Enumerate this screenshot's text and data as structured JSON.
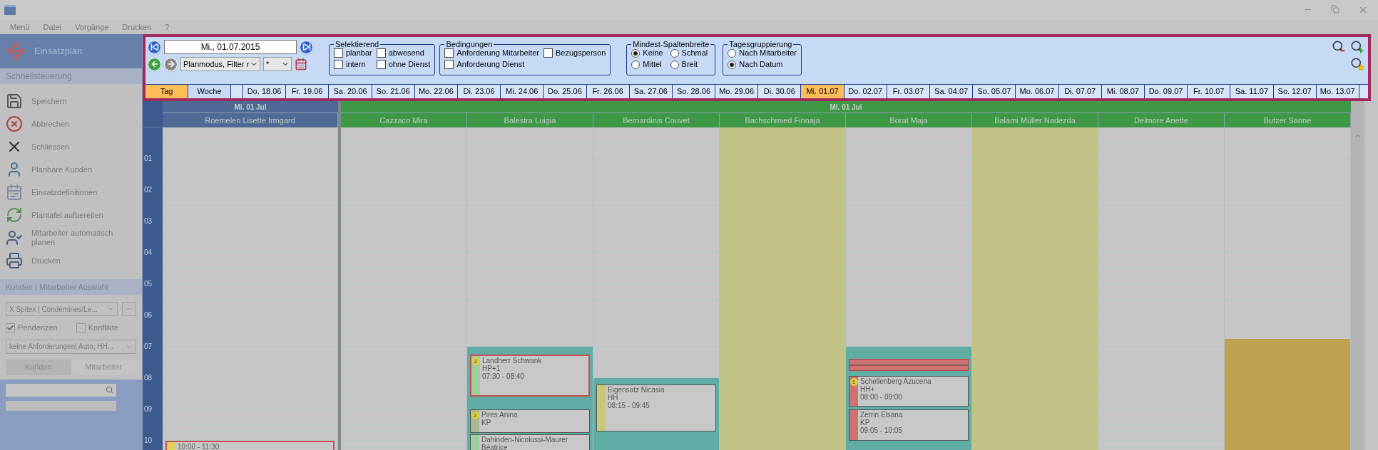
{
  "menu": [
    "Menü",
    "Datei",
    "Vorgänge",
    "Drucken",
    "?"
  ],
  "sidebar": {
    "title": "Einsatzplan",
    "section": "Schnellsteuerung",
    "actions": [
      "Speichern",
      "Abbrechen",
      "Schliessen",
      "Planbare Kunden",
      "Einsatzdefinitionen",
      "Plantafel aufbereiten",
      "Mitarbeiter automatisch planen",
      "Drucken"
    ],
    "selection": {
      "title": "Kunden / Mitarbeiter Auswahl",
      "filter": "X Spitex | Condémines/Le...",
      "checks": [
        {
          "label": "Pendenzen",
          "checked": true
        },
        {
          "label": "Konflikte",
          "checked": false
        }
      ],
      "requirements": "keine Anforderungen| Auto, HH...",
      "tabs": [
        {
          "label": "Kunden",
          "selected": true
        },
        {
          "label": "Mitarbeiter",
          "selected": false
        }
      ]
    }
  },
  "toolbar": {
    "date": "Mi., 01.07.2015",
    "mode": "Planmodus, Filter r",
    "filter": "*",
    "groups": [
      {
        "title": "Selektierend",
        "kind": "check",
        "options": [
          {
            "label": "planbar",
            "checked": false
          },
          {
            "label": "abwesend",
            "checked": false
          },
          {
            "label": "intern",
            "checked": false
          },
          {
            "label": "ohne Dienst",
            "checked": false
          }
        ]
      },
      {
        "title": "Bedingungen",
        "kind": "check",
        "options": [
          {
            "label": "Anforderung Mitarbeiter",
            "checked": false
          },
          {
            "label": "Bezugsperson",
            "checked": false
          },
          {
            "label": "Anforderung Dienst",
            "checked": false
          }
        ]
      },
      {
        "title": "Mindest-Spaltenbreite",
        "kind": "radio",
        "options": [
          {
            "label": "Keine",
            "selected": true
          },
          {
            "label": "Schmal",
            "selected": false
          },
          {
            "label": "Mittel",
            "selected": false
          },
          {
            "label": "Breit",
            "selected": false
          }
        ]
      },
      {
        "title": "Tagesgruppierung",
        "kind": "radio_list",
        "options": [
          {
            "label": "Nach Mitarbeiter",
            "selected": false
          },
          {
            "label": "Nach Datum",
            "selected": true
          }
        ]
      }
    ]
  },
  "day_tabs": [
    {
      "label": "Tag",
      "selected": true
    },
    {
      "label": "Woche",
      "selected": false
    }
  ],
  "dates": [
    {
      "label": "Do. 18.06",
      "selected": false
    },
    {
      "label": "Fr. 19.06",
      "selected": false
    },
    {
      "label": "Sa. 20.06",
      "selected": false
    },
    {
      "label": "So. 21.06",
      "selected": false
    },
    {
      "label": "Mo. 22.06",
      "selected": false
    },
    {
      "label": "Di. 23.06",
      "selected": false
    },
    {
      "label": "Mi. 24.06",
      "selected": false
    },
    {
      "label": "Do. 25.06",
      "selected": false
    },
    {
      "label": "Fr. 26.06",
      "selected": false
    },
    {
      "label": "Sa. 27.06",
      "selected": false
    },
    {
      "label": "So. 28.06",
      "selected": false
    },
    {
      "label": "Mo. 29.06",
      "selected": false
    },
    {
      "label": "Di. 30.06",
      "selected": false
    },
    {
      "label": "Mi. 01.07",
      "selected": true
    },
    {
      "label": "Do. 02.07",
      "selected": false
    },
    {
      "label": "Fr. 03.07",
      "selected": false
    },
    {
      "label": "Sa. 04.07",
      "selected": false
    },
    {
      "label": "So. 05.07",
      "selected": false
    },
    {
      "label": "Mo. 06.07",
      "selected": false
    },
    {
      "label": "Di. 07.07",
      "selected": false
    },
    {
      "label": "Mi. 08.07",
      "selected": false
    },
    {
      "label": "Do. 09.07",
      "selected": false
    },
    {
      "label": "Fr. 10.07",
      "selected": false
    },
    {
      "label": "Sa. 11.07",
      "selected": false
    },
    {
      "label": "So. 12.07",
      "selected": false
    },
    {
      "label": "Mo. 13.07",
      "selected": false
    }
  ],
  "calendar": {
    "hours": [
      "01",
      "02",
      "03",
      "04",
      "05",
      "06",
      "07",
      "08",
      "09",
      "10"
    ],
    "groups": [
      {
        "label": "Mi. 01 Jul",
        "color": "#4f6a96",
        "columns": [
          {
            "name": "Roemelen Lisette Irmgard",
            "kind": "free",
            "events": [
              {
                "kind": "conflict",
                "time": "10:00 - 11:30",
                "color": "#e0d060"
              }
            ]
          }
        ]
      },
      {
        "label": "Mi. 01 Jul",
        "color": "#3f9846",
        "columns": [
          {
            "name": "Cazzaco Mira",
            "kind": "free"
          },
          {
            "name": "Balestra Luigia",
            "kind": "free",
            "segments": [
              {
                "kind": "shift"
              }
            ],
            "events": [
              {
                "kind": "conflict",
                "name": "Landherr Schwank",
                "code": "HP+1",
                "time": "07:30 - 08:40",
                "badge": "2",
                "color": "#9fcf9f"
              },
              {
                "kind": "normal",
                "name": "Pires Anina",
                "code": "KP",
                "badge": "2",
                "color": "#a8b890"
              },
              {
                "kind": "normal",
                "name": "Dahinden-Nicolussi-Maurer",
                "code": "Béatrice",
                "color": "#9fcf9f"
              }
            ]
          },
          {
            "name": "Bernardinis Couvet",
            "kind": "free",
            "segments": [
              {
                "kind": "shift"
              }
            ],
            "events": [
              {
                "kind": "normal",
                "name": "Eigensatz Nicasia",
                "code": "HH",
                "time": "08:15 - 09:45",
                "color": "#c8c878"
              }
            ]
          },
          {
            "name": "Bachschmied Finnaja",
            "kind": "absent"
          },
          {
            "name": "Borat Maja",
            "kind": "free",
            "segments": [
              {
                "kind": "shift"
              }
            ],
            "events": [
              {
                "kind": "bar",
                "color": "#d07070"
              },
              {
                "kind": "bar",
                "color": "#d07070"
              },
              {
                "kind": "normal",
                "name": "Schellenberg Azucena",
                "code": "HH+",
                "time": "08:00 - 09:00",
                "badge": "1",
                "color": "#d07070"
              },
              {
                "kind": "normal",
                "name": "Zerrin Elsana",
                "code": "KP",
                "time": "09:05 - 10:05",
                "color": "#d07070"
              }
            ]
          },
          {
            "name": "Balami Müller Nadezda",
            "kind": "absent"
          },
          {
            "name": "Delmore Anette",
            "kind": "free"
          },
          {
            "name": "Butzer Sanne",
            "kind": "free",
            "segments": [
              {
                "kind": "absence"
              }
            ]
          }
        ]
      }
    ]
  }
}
